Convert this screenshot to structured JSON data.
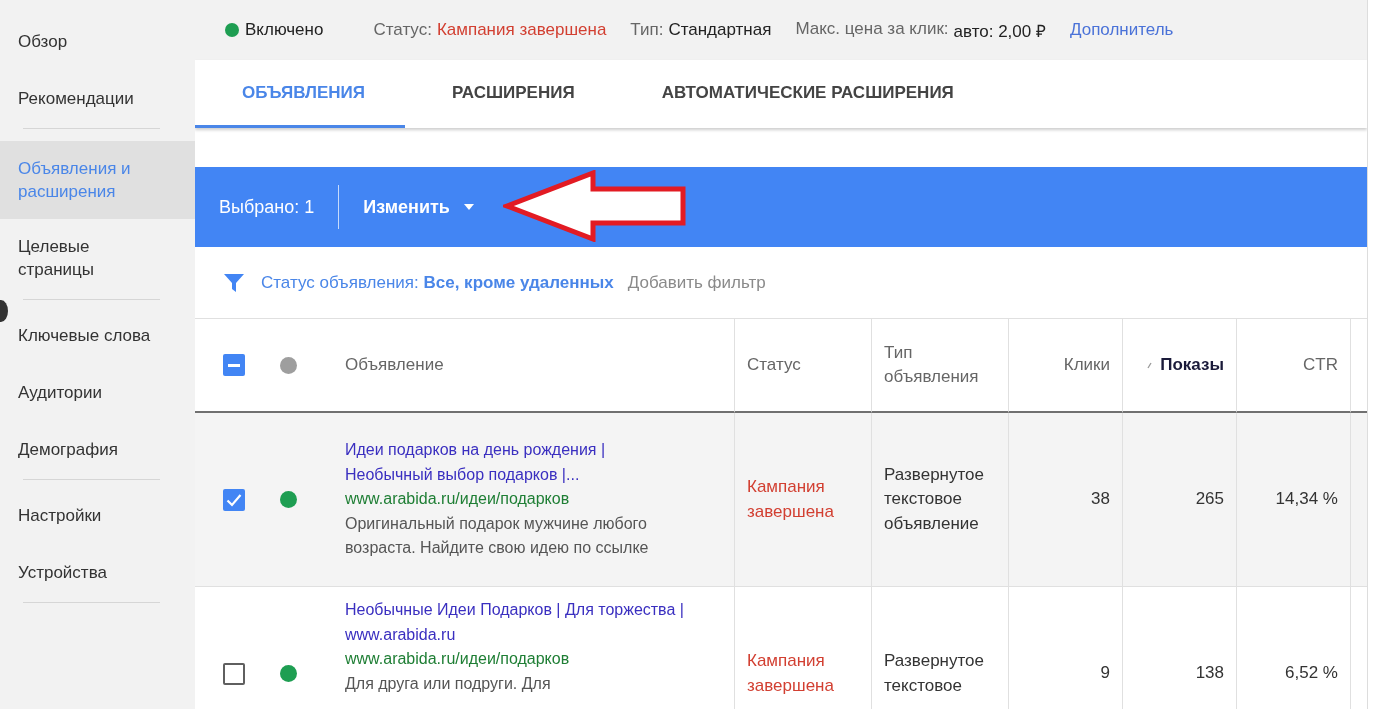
{
  "sidebar": {
    "groups": [
      [
        {
          "label": "Обзор",
          "selected": false
        },
        {
          "label": "Рекомендации",
          "selected": false
        }
      ],
      [
        {
          "label": "Объявления и расширения",
          "selected": true
        },
        {
          "label": "Целевые страницы",
          "selected": false
        }
      ],
      [
        {
          "label": "Ключевые слова",
          "selected": false
        },
        {
          "label": "Аудитории",
          "selected": false
        },
        {
          "label": "Демография",
          "selected": false
        }
      ],
      [
        {
          "label": "Настройки",
          "selected": false
        },
        {
          "label": "Устройства",
          "selected": false
        }
      ]
    ]
  },
  "campaign_bar": {
    "enabled": {
      "label": "Включено",
      "color": "#1e9e52"
    },
    "fields": [
      {
        "label": "Статус:",
        "value": "Кампания завершена",
        "kind": "alert"
      },
      {
        "label": "Тип:",
        "value": "Стандартная",
        "kind": "plain"
      },
      {
        "label": "Макс. цена за клик:",
        "value": "авто: 2,00 ₽",
        "kind": "plain"
      }
    ],
    "link": "Дополнитель"
  },
  "tabs": [
    {
      "label": "ОБЪЯВЛЕНИЯ",
      "selected": true
    },
    {
      "label": "РАСШИРЕНИЯ",
      "selected": false
    },
    {
      "label": "АВТОМАТИЧЕСКИЕ РАСШИРЕНИЯ",
      "selected": false
    }
  ],
  "selection_bar": {
    "count": "Выбрано: 1",
    "action": "Изменить"
  },
  "filter_bar": {
    "filter": "Статус объявления: **Все, кроме удаленных**",
    "add": "Добавить фильтр"
  },
  "table": {
    "select_all": {
      "indeterminate": true
    },
    "status_dot": {
      "color": "#9e9e9e"
    },
    "columns": [
      {
        "label": "Объявление",
        "sorted": false
      },
      {
        "label": "Статус",
        "sorted": false
      },
      {
        "label": "Тип объявления",
        "sorted": false
      },
      {
        "label": "Клики",
        "sorted": false
      },
      {
        "label": "Показы",
        "sorted": true
      },
      {
        "label": "CTR",
        "sorted": false
      }
    ],
    "rows": [
      {
        "selected": true,
        "checked": true,
        "color": "#1e9e52",
        "headline": "Идеи подарков на день рождения | Необычный выбор подарков |...",
        "url": "www.arabida.ru/идеи/подарков",
        "description": "Оригинальный подарок мужчине любого возраста. Найдите свою идею по ссылке",
        "status": "Кампания завершена",
        "type": "Развернутое текстовое объявление",
        "clicks": "38",
        "impressions": "265",
        "ctr": "14,34 %"
      },
      {
        "selected": false,
        "checked": false,
        "color": "#1e9e52",
        "headline": "Необычные Идеи Подарков | Для торжества | www.arabida.ru",
        "url": "www.arabida.ru/идеи/подарков",
        "description": "Для друга или подруги. Для",
        "status": "Кампания завершена",
        "type": "Развернутое текстовое",
        "clicks": "9",
        "impressions": "138",
        "ctr": "6,52 %"
      }
    ]
  }
}
